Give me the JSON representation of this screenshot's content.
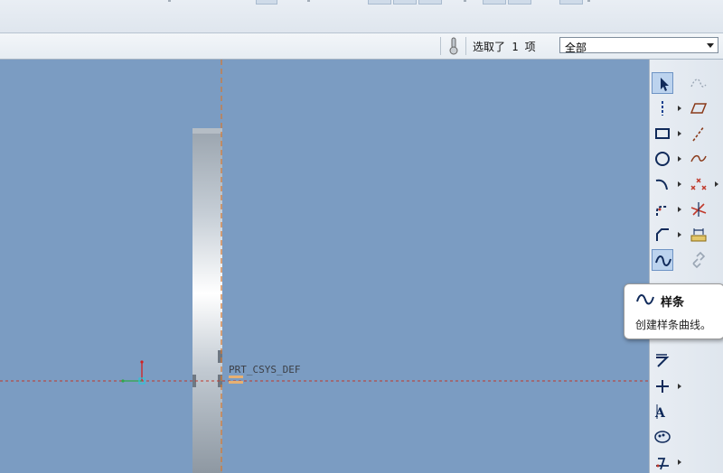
{
  "status": {
    "selection_text": "选取了 1 项",
    "filter": {
      "selected": "全部"
    }
  },
  "model": {
    "csys_label": "PRT_CSYS_DEF"
  },
  "tooltip": {
    "title": "样条",
    "description": "创建样条曲线。"
  },
  "toolbar": {
    "left_column": [
      "select-arrow-icon",
      "centerline-icon",
      "rectangle-icon",
      "circle-icon",
      "arc-icon",
      "fillet-icon",
      "chamfer-icon",
      "spline-icon",
      "text-icon",
      "axis-of-revolution-icon",
      "palette-icon",
      "divide-icon",
      "trim-icon",
      "point-icon",
      "thicken-icon"
    ],
    "right_column": [
      "offset-icon",
      "parallelogram-icon",
      "line-icon",
      "curve-icon",
      "points-icon",
      "delete-segment-icon",
      "dimension-icon",
      "constraint-icon"
    ]
  },
  "colors": {
    "graphics_background": "#7b9cc2",
    "datum_axis": "#d07a3a",
    "sketch_reference": "#c0392b",
    "accent_active": "#6d93c4"
  }
}
